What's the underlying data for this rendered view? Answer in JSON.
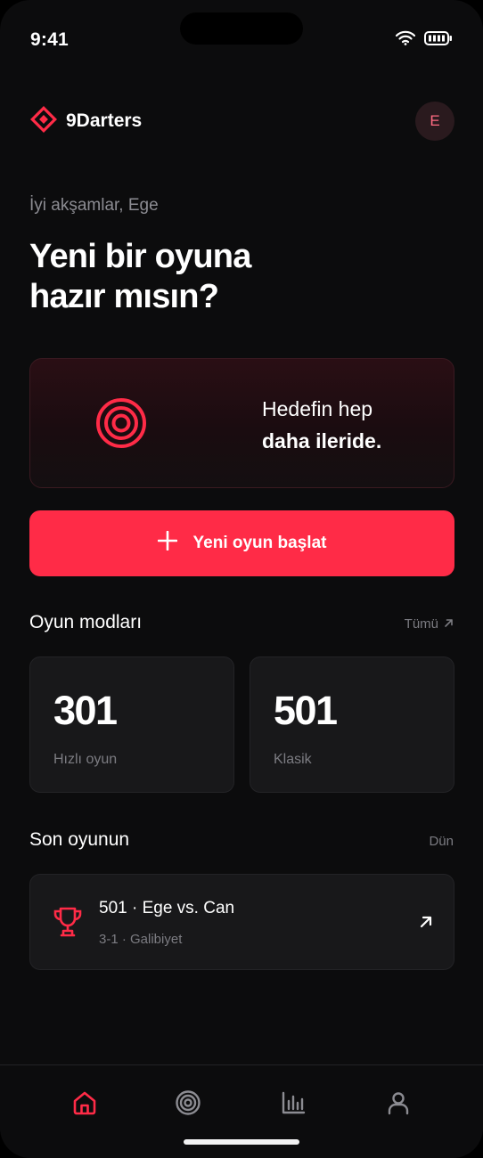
{
  "status_bar": {
    "time": "9:41"
  },
  "brand": {
    "name": "9Darters"
  },
  "avatar": {
    "initial": "E"
  },
  "greeting": "İyi akşamlar, Ege",
  "headline": {
    "line1": "Yeni bir oyuna",
    "line2": "hazır mısın?"
  },
  "hero": {
    "line1": "Hedefin hep",
    "line2": "daha ileride."
  },
  "primary_action": {
    "label": "Yeni oyun başlat"
  },
  "modes_section": {
    "title": "Oyun modları",
    "link": "Tümü",
    "items": [
      {
        "value": "301",
        "label": "Hızlı oyun"
      },
      {
        "value": "501",
        "label": "Klasik"
      }
    ]
  },
  "last_game_section": {
    "title": "Son oyunun",
    "link": "Dün",
    "game": {
      "title": "501 · Ege vs. Can",
      "subtitle": "3-1 · Galibiyet"
    }
  },
  "tabs": [
    {
      "icon": "home-icon",
      "active": true
    },
    {
      "icon": "target-icon",
      "active": false
    },
    {
      "icon": "stats-icon",
      "active": false
    },
    {
      "icon": "profile-icon",
      "active": false
    }
  ],
  "colors": {
    "accent": "#ff2b47",
    "background": "#0c0c0d",
    "card": "#18181a",
    "muted": "#7c7c82"
  }
}
